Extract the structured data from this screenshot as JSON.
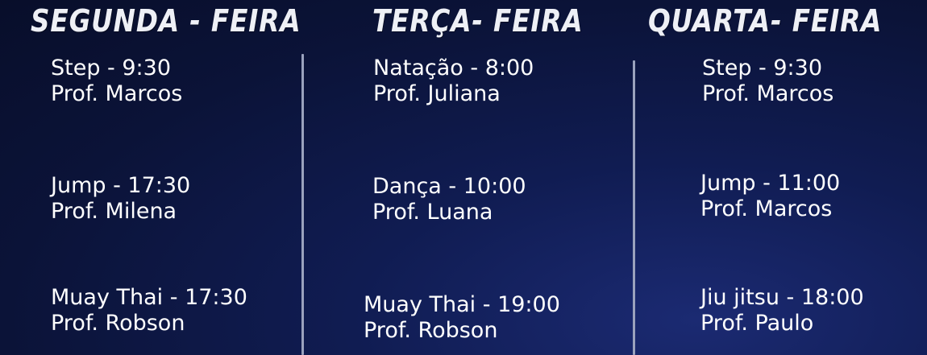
{
  "days": [
    {
      "title": "SEGUNDA - FEIRA",
      "classes": [
        {
          "activity": "Step - 9:30",
          "teacher": "Prof. Marcos"
        },
        {
          "activity": "Jump - 17:30",
          "teacher": "Prof. Milena"
        },
        {
          "activity": "Muay Thai - 17:30",
          "teacher": "Prof. Robson"
        }
      ]
    },
    {
      "title": "TERÇA- FEIRA",
      "classes": [
        {
          "activity": "Natação - 8:00",
          "teacher": "Prof. Juliana"
        },
        {
          "activity": "Dança - 10:00",
          "teacher": "Prof. Luana"
        },
        {
          "activity": "Muay Thai - 19:00",
          "teacher": "Prof. Robson"
        }
      ]
    },
    {
      "title": "QUARTA- FEIRA",
      "classes": [
        {
          "activity": "Step -  9:30",
          "teacher": "Prof. Marcos"
        },
        {
          "activity": "Jump - 11:00",
          "teacher": "Prof. Marcos"
        },
        {
          "activity": "Jiu jitsu - 18:00",
          "teacher": "Prof. Paulo"
        }
      ]
    }
  ],
  "colors": {
    "background": "#0b1338",
    "text": "#ffffff",
    "divider": "#9aa2bd"
  }
}
